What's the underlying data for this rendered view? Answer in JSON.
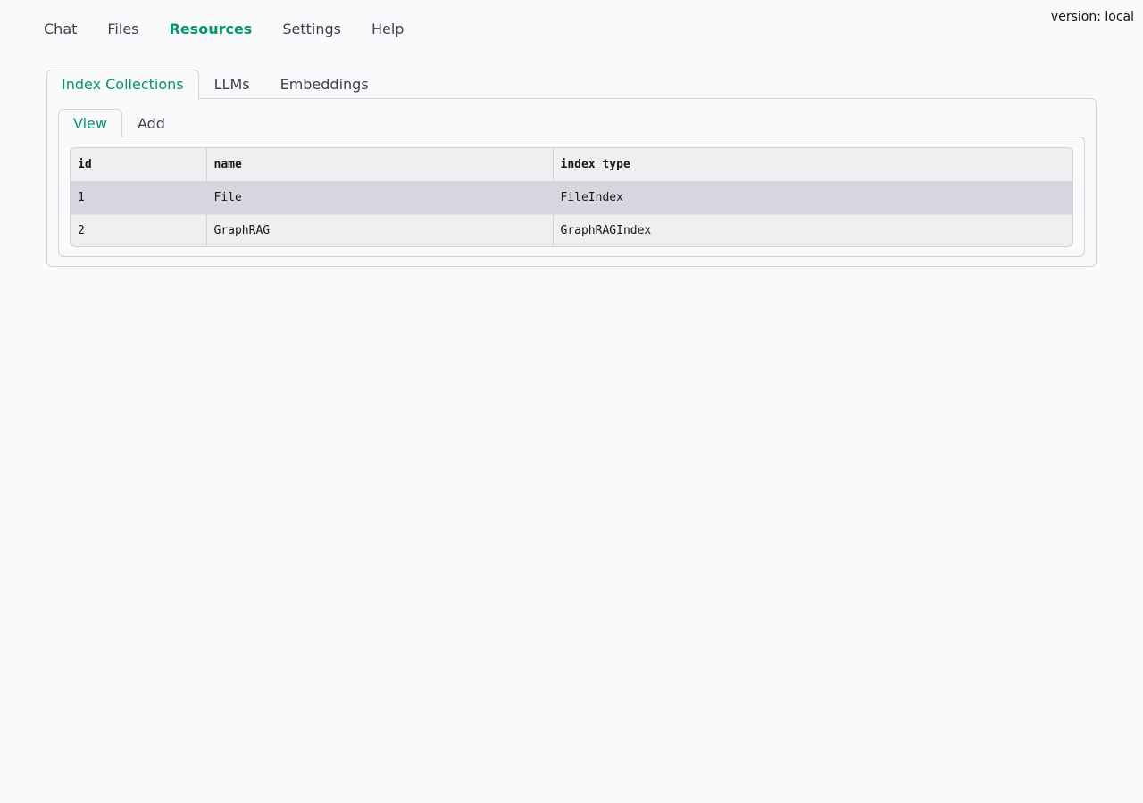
{
  "version_label": "version: local",
  "nav": {
    "items": [
      {
        "label": "Chat"
      },
      {
        "label": "Files"
      },
      {
        "label": "Resources"
      },
      {
        "label": "Settings"
      },
      {
        "label": "Help"
      }
    ],
    "active": "Resources"
  },
  "resource_tabs": {
    "items": [
      {
        "label": "Index Collections"
      },
      {
        "label": "LLMs"
      },
      {
        "label": "Embeddings"
      }
    ],
    "active": "Index Collections"
  },
  "sub_tabs": {
    "items": [
      {
        "label": "View"
      },
      {
        "label": "Add"
      }
    ],
    "active": "View"
  },
  "table": {
    "columns": [
      "id",
      "name",
      "index type"
    ],
    "rows": [
      [
        "1",
        "File",
        "FileIndex"
      ],
      [
        "2",
        "GraphRAG",
        "GraphRAGIndex"
      ]
    ],
    "selected_row": 0
  },
  "colors": {
    "accent": "#059669",
    "background": "#f8fafc",
    "border": "#d4d4d8",
    "selected_row": "#d6d7de",
    "row_bg": "#eeeff1"
  }
}
